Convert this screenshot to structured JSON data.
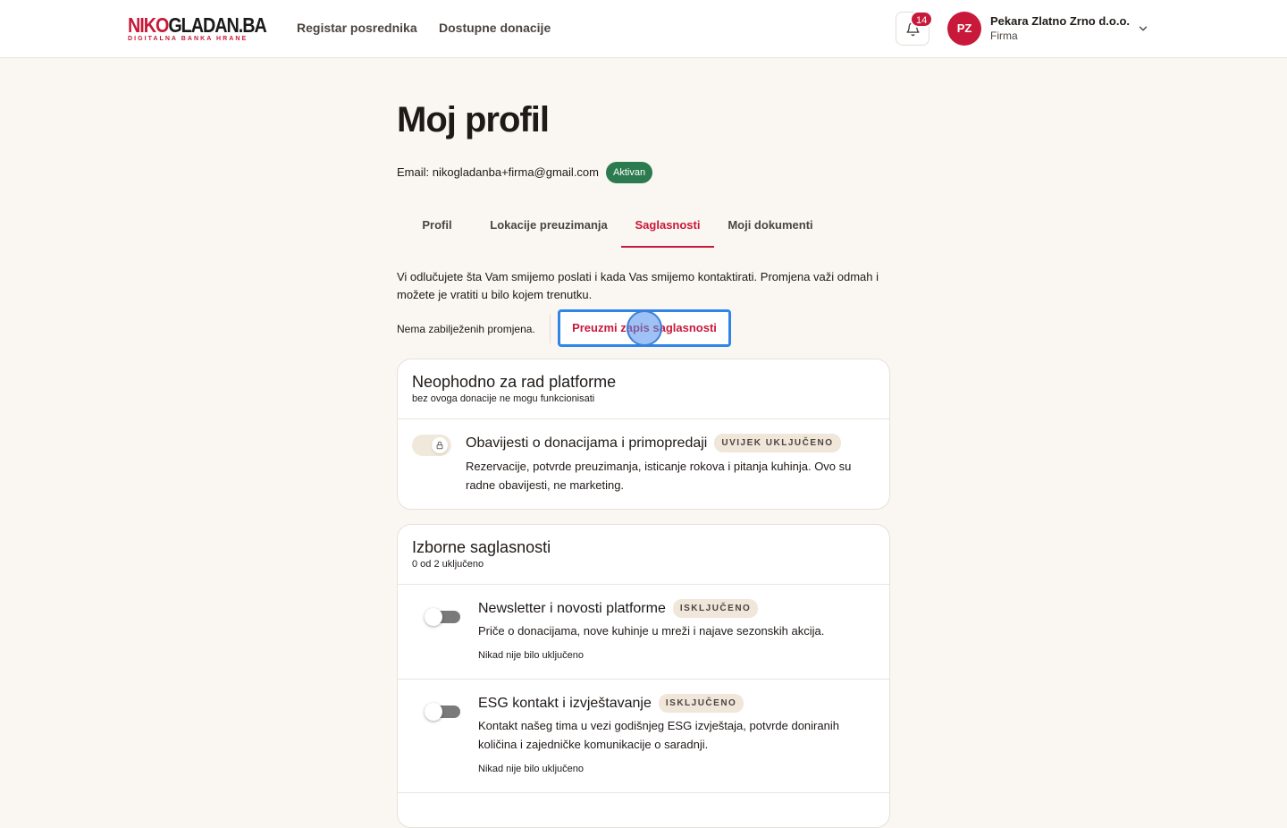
{
  "header": {
    "logo_part1": "NIKO",
    "logo_part2": "GLADAN.BA",
    "logo_tagline": "DIGITALNA BANKA HRANE",
    "nav": [
      "Registar posrednika",
      "Dostupne donacije"
    ],
    "notifications_count": "14",
    "user": {
      "initials": "PZ",
      "name": "Pekara Zlatno Zrno d.o.o.",
      "role": "Firma"
    }
  },
  "page": {
    "title": "Moj profil",
    "email": "Email: nikogladanba+firma@gmail.com",
    "status": "Aktivan",
    "tabs": [
      "Profil",
      "Lokacije preuzimanja",
      "Saglasnosti",
      "Moji dokumenti"
    ],
    "active_tab": "Saglasnosti",
    "intro": "Vi odlučujete šta Vam smijemo poslati i kada Vas smijemo kontaktirati. Promjena važi odmah i možete je vratiti u bilo kojem trenutku.",
    "no_changes": "Nema zabilježenih promjena.",
    "download_button": "Preuzmi zapis saglasnosti"
  },
  "required_section": {
    "title": "Neophodno za rad platforme",
    "subtitle": "bez ovoga donacije ne mogu funkcionisati",
    "items": [
      {
        "title": "Obavijesti o donacijama i primopredaji",
        "tag": "UVIJEK UKLJUČENO",
        "description": "Rezervacije, potvrde preuzimanja, isticanje rokova i pitanja kuhinja. Ovo su radne obavijesti, ne marketing."
      }
    ]
  },
  "optional_section": {
    "title": "Izborne saglasnosti",
    "subtitle": "0 od 2 uključeno",
    "items": [
      {
        "title": "Newsletter i novosti platforme",
        "tag": "ISKLJUČENO",
        "enabled": false,
        "description": "Priče o donacijama, nove kuhinje u mreži i najave sezonskih akcija.",
        "meta": "Nikad nije bilo uključeno"
      },
      {
        "title": "ESG kontakt i izvještavanje",
        "tag": "ISKLJUČENO",
        "enabled": false,
        "description": "Kontakt našeg tima u vezi godišnjeg ESG izvještaja, potvrde doniranih količina i zajedničke komunikacije o saradnji.",
        "meta": "Nikad nije bilo uključeno"
      }
    ]
  },
  "colors": {
    "brand": "#c8193a",
    "success": "#2c7a4f",
    "focus": "#2f86e8",
    "background": "#faf6f1"
  }
}
